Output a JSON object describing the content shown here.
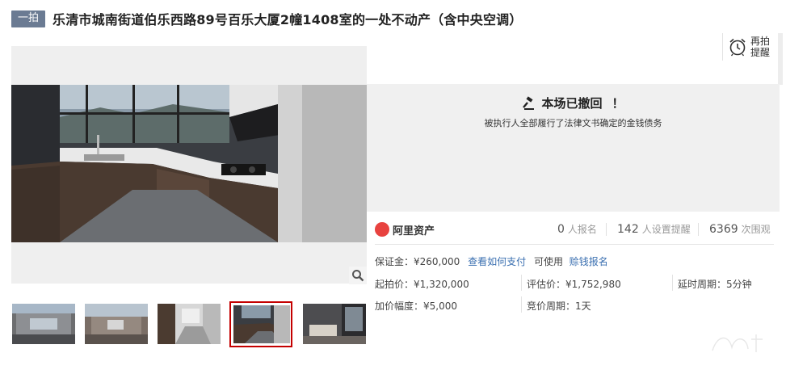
{
  "header": {
    "tag": "一拍",
    "title": "乐清市城南街道伯乐西路89号百乐大厦2幢1408室的一处不动产（含中央空调）"
  },
  "reminder": {
    "label": "再拍提醒",
    "icon": "alarm-clock-icon"
  },
  "status": {
    "headline": "本场已撤回",
    "exclaim": "！",
    "detail": "被执行人全部履行了法律文书确定的金钱债务",
    "icon": "gavel-icon"
  },
  "stats": {
    "platform": "阿里资产",
    "signups": {
      "value": "0",
      "unit": "人报名"
    },
    "reminders": {
      "value": "142",
      "unit": "人设置提醒"
    },
    "views": {
      "value": "6369",
      "unit": "次围观"
    }
  },
  "deposit": {
    "label": "保证金：¥260,000",
    "link_pay": "查看如何支付",
    "usable": "可使用",
    "link_credit": "赊钱报名"
  },
  "prices": {
    "start": "起拍价：¥1,320,000",
    "assessed": "评估价：¥1,752,980",
    "delay": "延时周期：5分钟",
    "increment": "加价幅度：¥5,000",
    "bid_period": "竞价周期：1天"
  },
  "colors": {
    "tag_bg": "#6b7b93",
    "link": "#3a6fb0",
    "active_thumb_border": "#c40000",
    "brand_red": "#e8423f",
    "status_bg": "#f0f0f0"
  }
}
